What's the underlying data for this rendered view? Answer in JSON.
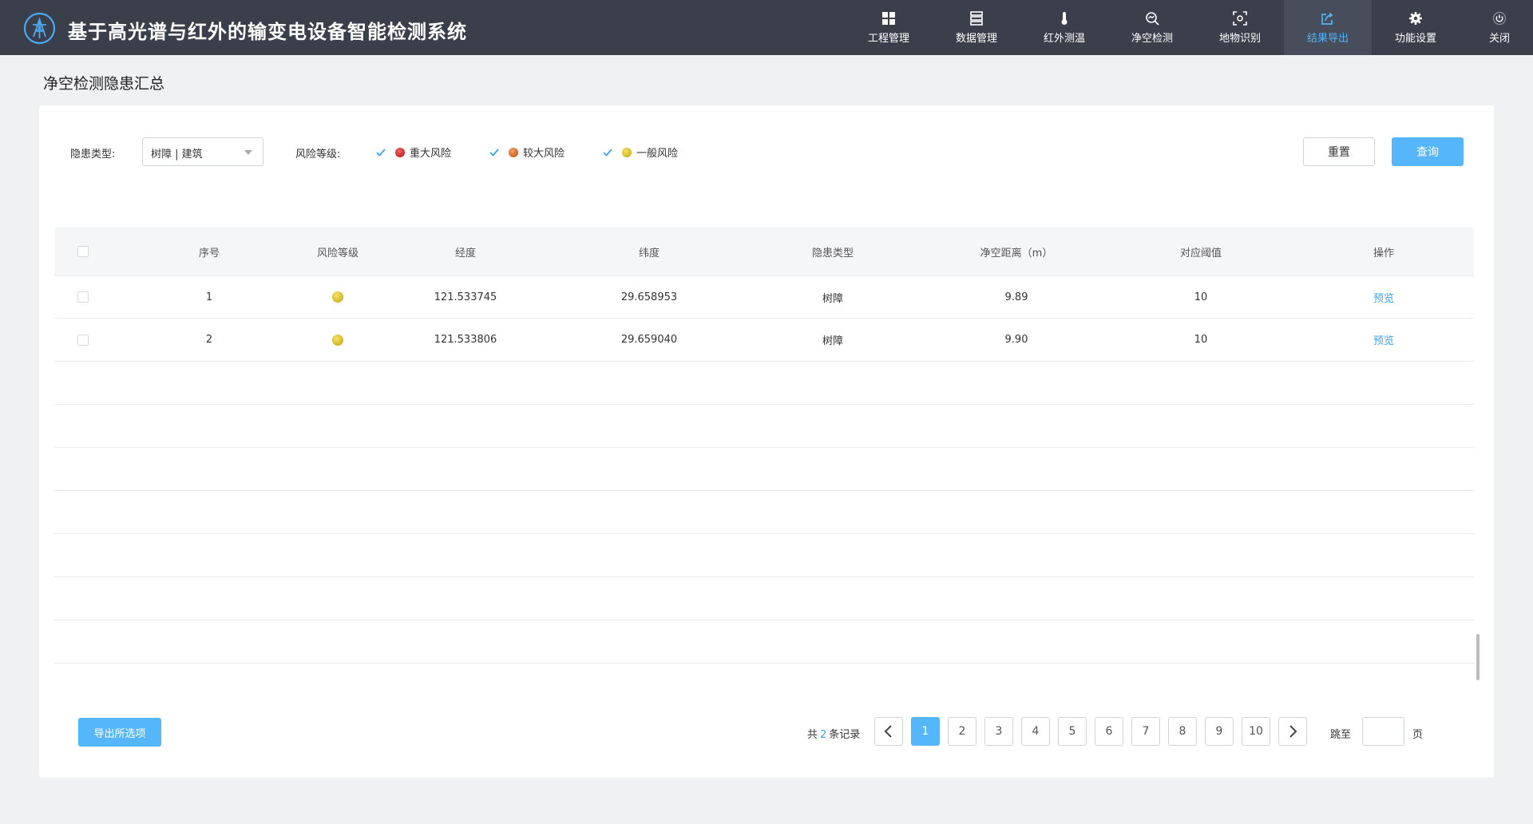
{
  "header": {
    "title": "基于高光谱与红外的输变电设备智能检测系统",
    "nav": [
      {
        "label": "工程管理",
        "icon": "grid-icon"
      },
      {
        "label": "数据管理",
        "icon": "database-icon"
      },
      {
        "label": "红外测温",
        "icon": "thermometer-icon"
      },
      {
        "label": "净空检测",
        "icon": "scan-search-icon"
      },
      {
        "label": "地物识别",
        "icon": "object-recognition-icon"
      },
      {
        "label": "结果导出",
        "icon": "export-share-icon",
        "active": true
      },
      {
        "label": "功能设置",
        "icon": "gear-icon"
      },
      {
        "label": "关闭",
        "icon": "power-icon"
      }
    ]
  },
  "page": {
    "title": "净空检测隐患汇总"
  },
  "filters": {
    "hazard_type_label": "隐患类型:",
    "hazard_type_value": "树障 | 建筑",
    "risk_level_label": "风险等级:",
    "risk_options": [
      {
        "label": "重大风险",
        "checked": true,
        "color": "#d9383a"
      },
      {
        "label": "较大风险",
        "checked": true,
        "color": "#e07b39"
      },
      {
        "label": "一般风险",
        "checked": true,
        "color": "#d9c22e"
      }
    ],
    "reset_label": "重置",
    "query_label": "查询"
  },
  "table": {
    "columns": [
      "序号",
      "风险等级",
      "经度",
      "纬度",
      "隐患类型",
      "净空距离（m）",
      "对应阈值",
      "操作"
    ],
    "rows": [
      {
        "index": "1",
        "risk": "一般风险",
        "longitude": "121.533745",
        "latitude": "29.658953",
        "type": "树障",
        "distance": "9.89",
        "threshold": "10",
        "action": "预览"
      },
      {
        "index": "2",
        "risk": "一般风险",
        "longitude": "121.533806",
        "latitude": "29.659040",
        "type": "树障",
        "distance": "9.90",
        "threshold": "10",
        "action": "预览"
      }
    ]
  },
  "footer": {
    "export_label": "导出所选项",
    "total_prefix": "共",
    "total_count": "2",
    "total_suffix": "条记录",
    "pages": [
      "1",
      "2",
      "3",
      "4",
      "5",
      "6",
      "7",
      "8",
      "9",
      "10"
    ],
    "current_page": "1",
    "jump_label": "跳至",
    "page_unit": "页"
  },
  "colors": {
    "accent": "#56b6fb",
    "header_bg": "#3a3f4b",
    "active_nav": "#53b3f5"
  }
}
